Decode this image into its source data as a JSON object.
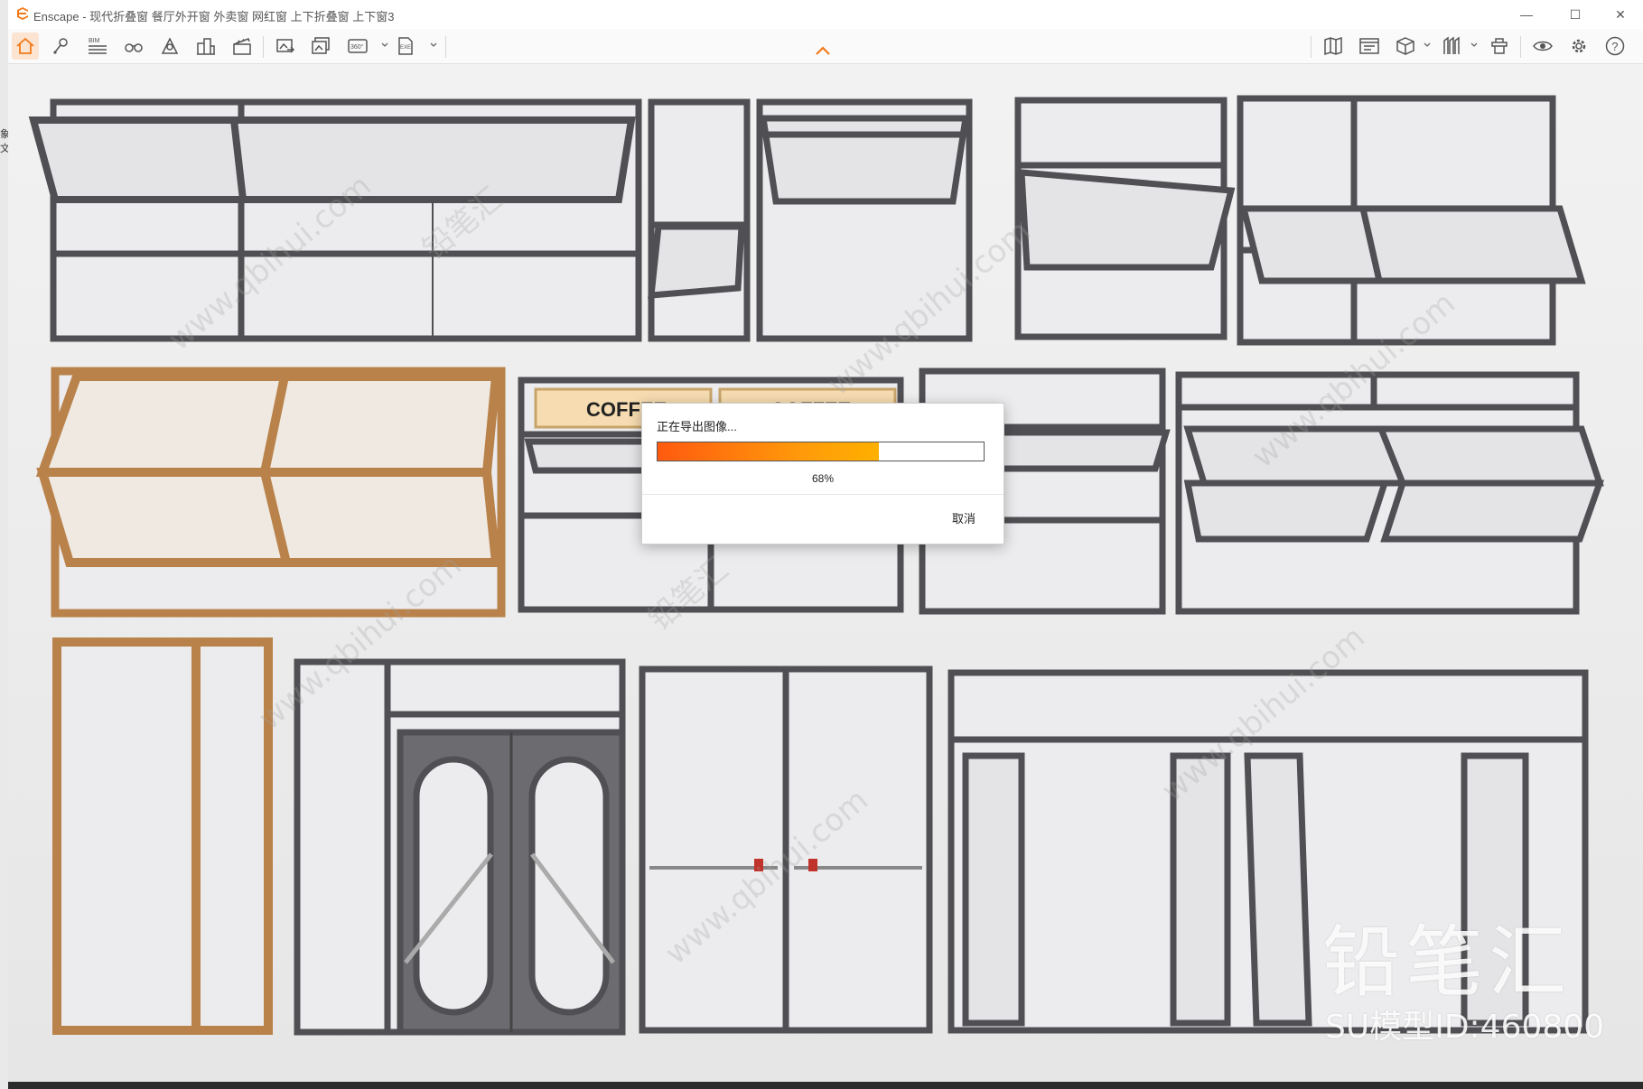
{
  "desktop": {
    "left_chars": [
      "象",
      "文"
    ]
  },
  "window": {
    "app_name": "Enscape",
    "title": "Enscape - 现代折叠窗 餐厅外开窗 外卖窗 网红窗 上下折叠窗 上下窗3",
    "controls": {
      "minimize": "—",
      "maximize": "☐",
      "close": "✕"
    }
  },
  "toolbar": {
    "left_tools": [
      {
        "name": "home-icon",
        "active": true
      },
      {
        "name": "location-pin-icon"
      },
      {
        "name": "bim-icon",
        "label": "BIM"
      },
      {
        "name": "binoculars-icon"
      },
      {
        "name": "sun-icon"
      },
      {
        "name": "buildings-icon"
      },
      {
        "name": "clapperboard-icon"
      },
      {
        "name": "render-image-icon"
      },
      {
        "name": "batch-render-icon"
      },
      {
        "name": "panorama-360-icon",
        "label": "360°"
      },
      {
        "name": "export-exe-icon",
        "label": "EXE"
      }
    ],
    "right_tools": [
      {
        "name": "map-icon"
      },
      {
        "name": "video-editor-icon"
      },
      {
        "name": "cube-icon"
      },
      {
        "name": "asset-library-icon"
      },
      {
        "name": "material-editor-icon"
      },
      {
        "name": "visual-settings-icon"
      },
      {
        "name": "settings-gear-icon"
      },
      {
        "name": "help-icon",
        "label": "?"
      }
    ],
    "accent": "#f07a1a"
  },
  "scene": {
    "sign_text": "COFFEE",
    "frame_dark": "#555558",
    "frame_wood": "#b9824a",
    "glass": "#ebebed"
  },
  "dialog": {
    "title": "正在导出图像...",
    "progress": 0.68,
    "percent_label": "68%",
    "cancel_label": "取消"
  },
  "watermark": {
    "brand": "铅笔汇",
    "model_id": "SU模型ID:460800",
    "site": "www.qbihui.com",
    "repeat_text": "铅笔汇"
  }
}
